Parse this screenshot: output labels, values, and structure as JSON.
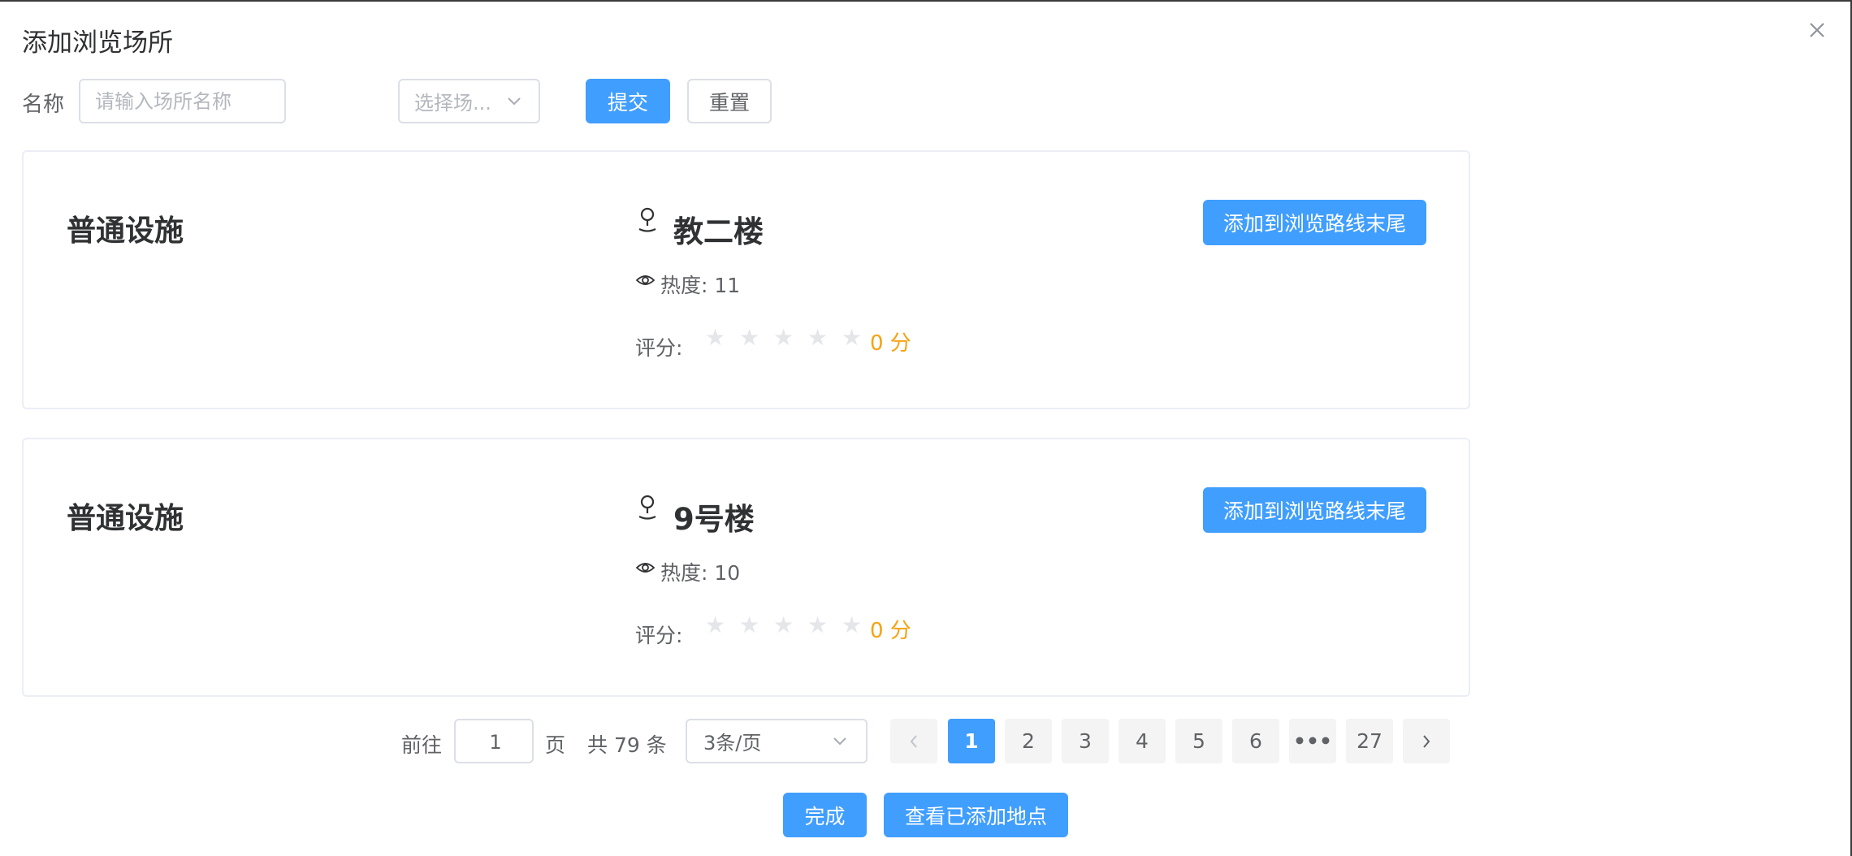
{
  "dialog": {
    "title": "添加浏览场所"
  },
  "filter": {
    "name_label": "名称",
    "name_placeholder": "请输入场所名称",
    "type_placeholder": "选择场...",
    "submit_label": "提交",
    "reset_label": "重置"
  },
  "places": [
    {
      "category": "普通设施",
      "name": "教二楼",
      "heat_text": "热度: 11",
      "rating_label": "评分:",
      "rating": 0,
      "max_rating": 5,
      "score_text": "0 分",
      "add_label": "添加到浏览路线末尾"
    },
    {
      "category": "普通设施",
      "name": "9号楼",
      "heat_text": "热度: 10",
      "rating_label": "评分:",
      "rating": 0,
      "max_rating": 5,
      "score_text": "0 分",
      "add_label": "添加到浏览路线末尾"
    }
  ],
  "pagination": {
    "goto_label": "前往",
    "goto_value": "1",
    "page_suffix": "页",
    "total_text": "共 79 条",
    "page_size_text": "3条/页",
    "pages": [
      "1",
      "2",
      "3",
      "4",
      "5",
      "6",
      "•••",
      "27"
    ],
    "current_page": "1"
  },
  "footer": {
    "finish_label": "完成",
    "view_added_label": "查看已添加地点"
  },
  "colors": {
    "primary": "#409eff",
    "score": "#f7a211",
    "star_empty": "#e4e6ea"
  },
  "icons": {
    "close": "close-icon",
    "location": "location-pin-icon",
    "eye": "eye-icon",
    "star": "star-icon",
    "chevron": "chevron-down-icon"
  }
}
